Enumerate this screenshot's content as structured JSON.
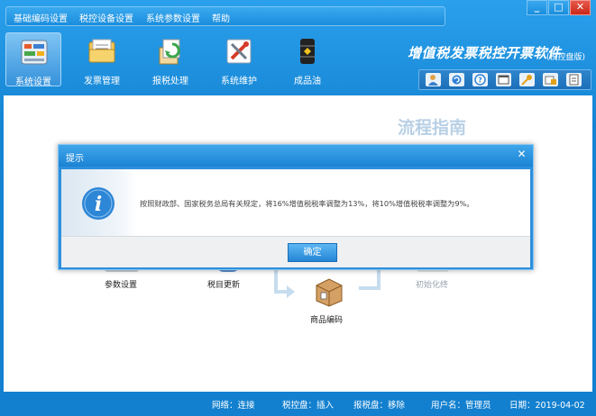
{
  "menu": {
    "items": [
      {
        "label": "基础编码设置"
      },
      {
        "label": "税控设备设置"
      },
      {
        "label": "系统参数设置"
      },
      {
        "label": "帮助"
      }
    ]
  },
  "window_controls": {
    "minimize": "_",
    "maximize": "□",
    "close": "✕"
  },
  "toolbar": {
    "items": [
      {
        "label": "系统设置",
        "icon": "settings-panel-icon",
        "active": true
      },
      {
        "label": "发票管理",
        "icon": "invoice-folder-icon"
      },
      {
        "label": "报税处理",
        "icon": "tax-report-icon"
      },
      {
        "label": "系统维护",
        "icon": "maintenance-tools-icon"
      },
      {
        "label": "成品油",
        "icon": "oil-barrel-icon"
      }
    ]
  },
  "app": {
    "title": "增值税发票税控开票软件",
    "subtitle": "(税控盘版)"
  },
  "quick_actions": [
    "user-icon",
    "refresh-icon",
    "help-icon",
    "window-icon",
    "key-icon",
    "lock-icon",
    "clipboard-icon"
  ],
  "content": {
    "guide_title": "流程指南",
    "flow_labels": {
      "param_settings": "参数设置",
      "tax_update": "税目更新",
      "product_code": "商品编码",
      "init_end": "初始化终"
    }
  },
  "dialog": {
    "title": "提示",
    "close": "✕",
    "message": "按照财政部、国家税务总局有关规定，将16%增值税税率调整为13%，将10%增值税税率调整为9%。",
    "ok_label": "确定"
  },
  "status": {
    "network": "网络：连接",
    "tax_disk": "税控盘：插入",
    "report_disk": "报税盘：移除",
    "username": "用户名：管理员",
    "date": "日期：2019-04-02"
  }
}
